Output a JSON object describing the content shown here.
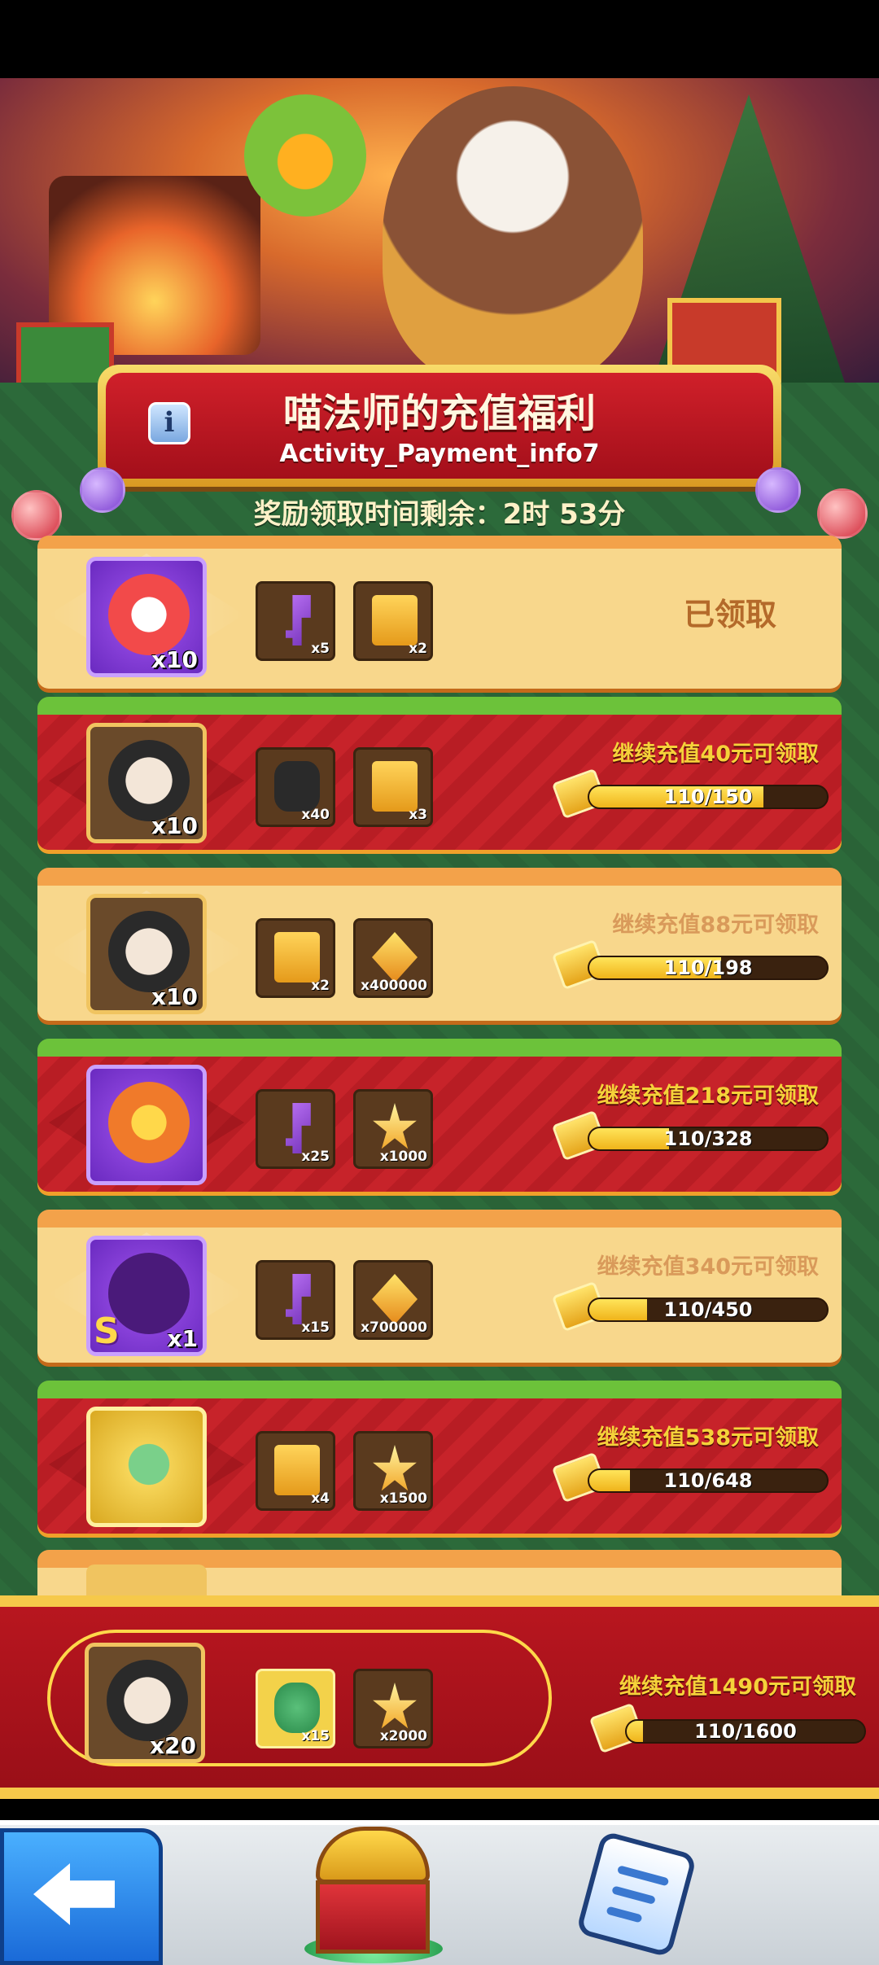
{
  "header": {
    "title": "喵法师的充值福利",
    "subtitle": "Activity_Payment_info7",
    "info_label": "i",
    "timer_text": "奖励领取时间剩余：2时 53分"
  },
  "rows": [
    {
      "style": "claimed",
      "main": {
        "icon": "lion-hat-icon",
        "count": "x10",
        "frame": "purple"
      },
      "items": [
        {
          "icon": "purple-key-icon",
          "qty": "x5"
        },
        {
          "icon": "gold-card-icon",
          "qty": "x2"
        }
      ],
      "status_text": "已领取"
    },
    {
      "style": "red",
      "main": {
        "icon": "ninja-puzzle-icon",
        "count": "x10",
        "frame": "brown"
      },
      "items": [
        {
          "icon": "mystery-puzzle-icon",
          "qty": "x40"
        },
        {
          "icon": "gold-card-icon",
          "qty": "x3"
        }
      ],
      "requirement": "继续充值40元可领取",
      "progress_text": "110/150",
      "progress": 0.733
    },
    {
      "style": "light",
      "main": {
        "icon": "ninja-puzzle-icon",
        "count": "x10",
        "frame": "brown"
      },
      "items": [
        {
          "icon": "gold-card-icon",
          "qty": "x2"
        },
        {
          "icon": "gold-diamond-coin-icon",
          "qty": "x400000"
        }
      ],
      "requirement": "继续充值88元可领取",
      "progress_text": "110/198",
      "progress": 0.556
    },
    {
      "style": "red",
      "main": {
        "icon": "tiger-mask-icon",
        "count": "",
        "frame": "purple"
      },
      "items": [
        {
          "icon": "purple-key-icon",
          "qty": "x25"
        },
        {
          "icon": "gold-star-icon",
          "qty": "x1000"
        }
      ],
      "requirement": "继续充值218元可领取",
      "progress_text": "110/328",
      "progress": 0.335
    },
    {
      "style": "light",
      "main": {
        "icon": "mystery-s-icon",
        "count": "x1",
        "frame": "purple",
        "badge": "S"
      },
      "items": [
        {
          "icon": "purple-key-icon",
          "qty": "x15"
        },
        {
          "icon": "gold-diamond-coin-icon",
          "qty": "x700000"
        }
      ],
      "requirement": "继续充值340元可领取",
      "progress_text": "110/450",
      "progress": 0.244
    },
    {
      "style": "red",
      "main": {
        "icon": "jade-dragon-icon",
        "count": "",
        "frame": "gold"
      },
      "items": [
        {
          "icon": "gold-card-icon",
          "qty": "x4"
        },
        {
          "icon": "gold-star-icon",
          "qty": "x1500"
        }
      ],
      "requirement": "继续充值538元可领取",
      "progress_text": "110/648",
      "progress": 0.17
    }
  ],
  "featured": {
    "main": {
      "icon": "ninja-puzzle-icon",
      "count": "x20"
    },
    "items": [
      {
        "icon": "jade-dragon-icon",
        "qty": "x15"
      },
      {
        "icon": "gold-star-icon",
        "qty": "x2000"
      }
    ],
    "requirement": "继续充值1490元可领取",
    "progress_text": "110/1600",
    "progress": 0.069
  },
  "colors": {
    "board_green": "#2c6a3a",
    "row_light": "#f8d78c",
    "row_red": "#c7232a",
    "progress_fill": "#f5c82a",
    "requirement_text": "#f5d23a"
  },
  "nav": {
    "back_icon": "back-arrow-icon",
    "chest_icon": "treasure-chest-icon",
    "clipboard_icon": "clipboard-icon"
  }
}
